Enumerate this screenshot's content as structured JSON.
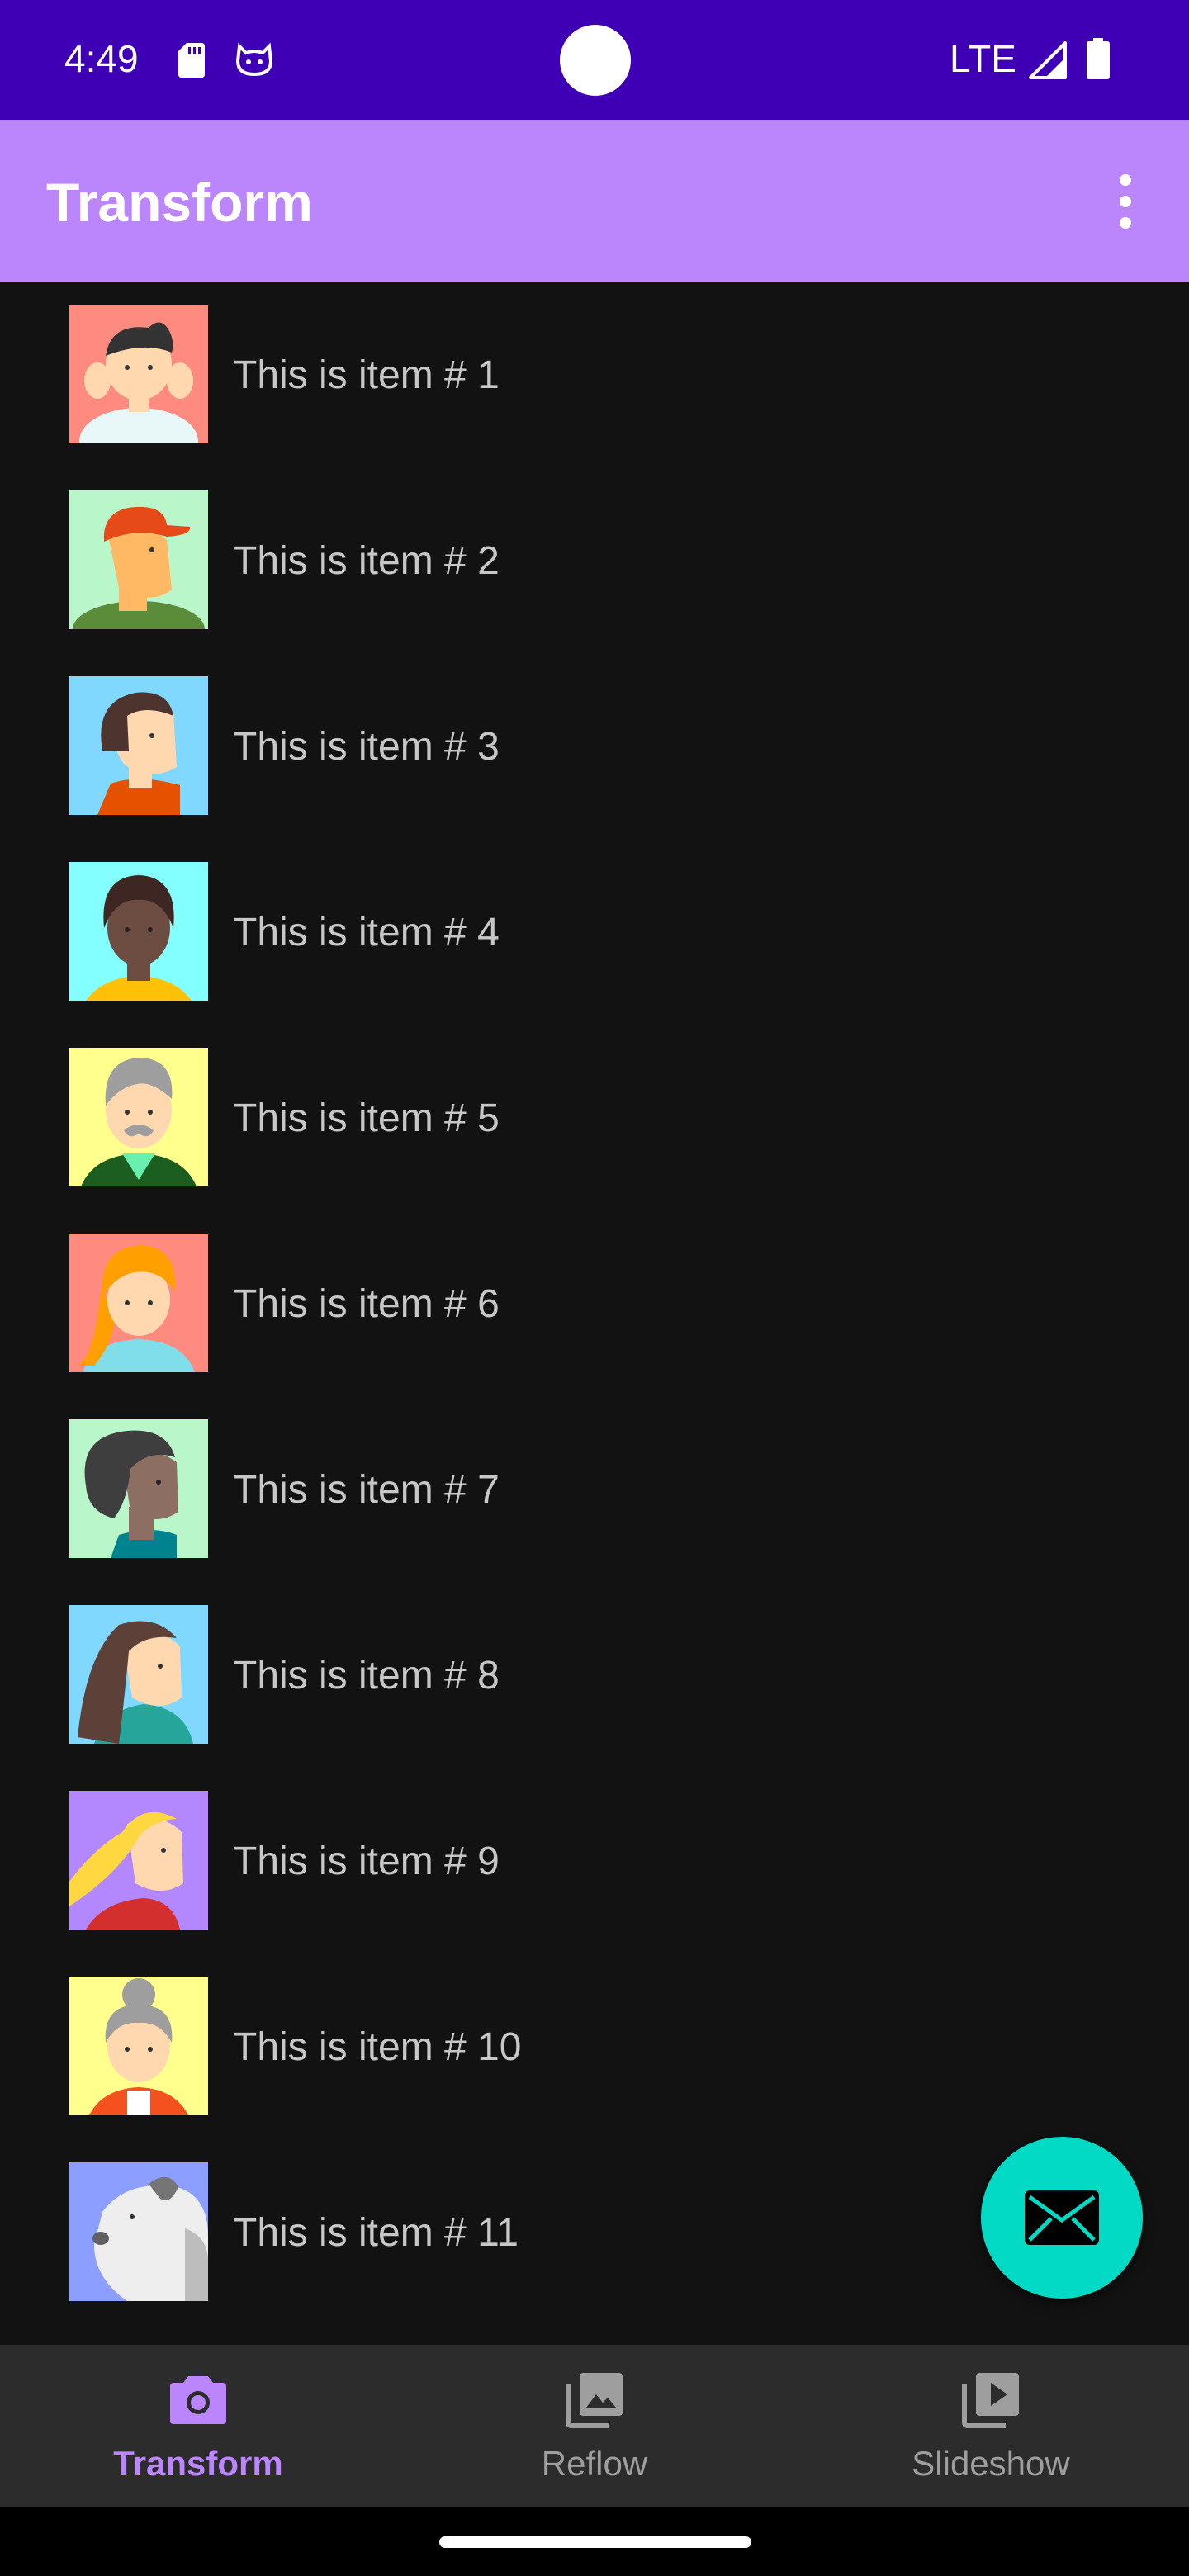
{
  "status_bar": {
    "time": "4:49",
    "network": "LTE",
    "icons": [
      "sd-card-icon",
      "cat-notification-icon",
      "signal-icon",
      "battery-icon"
    ],
    "background": "#3f00b5"
  },
  "app_bar": {
    "title": "Transform",
    "overflow_icon": "more-vert-icon",
    "background": "#bb86fc"
  },
  "list": {
    "items": [
      {
        "label": "This is item # 1",
        "avatar_bg": "#ff8a80"
      },
      {
        "label": "This is item # 2",
        "avatar_bg": "#b9f6ca"
      },
      {
        "label": "This is item # 3",
        "avatar_bg": "#80d8ff"
      },
      {
        "label": "This is item # 4",
        "avatar_bg": "#84ffff"
      },
      {
        "label": "This is item # 5",
        "avatar_bg": "#ffff8d"
      },
      {
        "label": "This is item # 6",
        "avatar_bg": "#ff8a80"
      },
      {
        "label": "This is item # 7",
        "avatar_bg": "#b9f6ca"
      },
      {
        "label": "This is item # 8",
        "avatar_bg": "#80d8ff"
      },
      {
        "label": "This is item # 9",
        "avatar_bg": "#b388ff"
      },
      {
        "label": "This is item # 10",
        "avatar_bg": "#ffff8d"
      },
      {
        "label": "This is item # 11",
        "avatar_bg": "#8c9eff"
      }
    ]
  },
  "fab": {
    "icon": "email-icon",
    "color": "#03dac5"
  },
  "bottom_nav": {
    "items": [
      {
        "label": "Transform",
        "icon": "camera-icon",
        "active": true
      },
      {
        "label": "Reflow",
        "icon": "image-library-icon",
        "active": false
      },
      {
        "label": "Slideshow",
        "icon": "video-library-icon",
        "active": false
      }
    ],
    "active_color": "#bb86fc"
  }
}
